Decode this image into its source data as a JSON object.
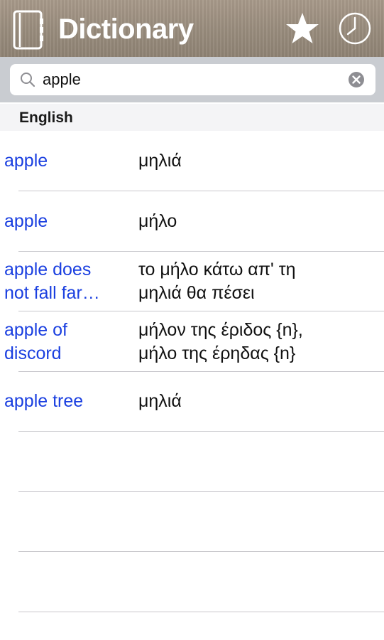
{
  "header": {
    "title": "Dictionary",
    "icons": [
      "book-icon",
      "star-icon",
      "clock-icon"
    ]
  },
  "search": {
    "value": "apple",
    "icons": [
      "search-icon",
      "clear-icon"
    ]
  },
  "section": {
    "label": "English"
  },
  "results": [
    {
      "term": "apple",
      "translation": "μηλιά"
    },
    {
      "term": "apple",
      "translation": "μήλο"
    },
    {
      "term": "apple does\nnot fall far…",
      "translation": "το μήλο κάτω απ' τη\nμηλιά θα πέσει"
    },
    {
      "term": "apple of\ndiscord",
      "translation": "μήλον της έριδος {n},\nμήλο της έρηδας {n}"
    },
    {
      "term": "apple tree",
      "translation": "μηλιά"
    }
  ],
  "colors": {
    "link": "#1a3fe0",
    "header_bg": "#9a8d7e",
    "search_bar_bg": "#c9ccd1",
    "separator": "#c8c7cc"
  }
}
